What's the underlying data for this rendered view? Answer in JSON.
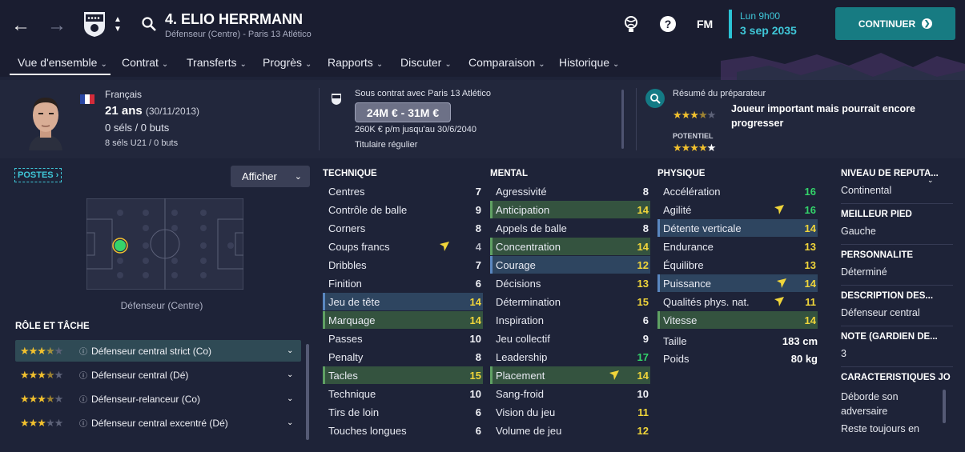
{
  "header": {
    "player_name": "4. ELIO HERRMANN",
    "player_sub": "Défenseur (Centre) - Paris 13 Atlético",
    "fm_logo": "FM",
    "date_day": "Lun 9h00",
    "date_full": "3 sep 2035",
    "continue_label": "CONTINUER"
  },
  "nav": {
    "items": [
      {
        "label": "Vue d'ensemble"
      },
      {
        "label": "Contrat"
      },
      {
        "label": "Transferts"
      },
      {
        "label": "Progrès"
      },
      {
        "label": "Rapports"
      },
      {
        "label": "Discuter"
      },
      {
        "label": "Comparaison"
      },
      {
        "label": "Historique"
      }
    ]
  },
  "profile": {
    "nationality": "Français",
    "age": "21 ans",
    "dob": "(30/11/2013)",
    "caps": "0 séls / 0 buts",
    "caps_u21": "8 séls U21 / 0 buts",
    "contract_title": "Sous contrat avec Paris 13 Atlético",
    "value": "24M € - 31M €",
    "wage": "260K € p/m jusqu'au 30/6/2040",
    "status": "Titulaire régulier",
    "scout_title": "Résumé du préparateur",
    "scout_text": "Joueur important mais pourrait encore progresser",
    "scout_stars": 3.5,
    "potential_label": "POTENTIEL",
    "potential_stars": 4.5
  },
  "left_panel": {
    "postes_label": "POSTES",
    "afficher_label": "Afficher",
    "position_label": "Défenseur (Centre)",
    "role_heading": "RÔLE ET TÂCHE",
    "roles": [
      {
        "name": "Défenseur central strict (Co)",
        "stars": 3.5,
        "selected": true
      },
      {
        "name": "Défenseur central (Dé)",
        "stars": 3.5,
        "selected": false
      },
      {
        "name": "Défenseur-relanceur (Co)",
        "stars": 3.5,
        "selected": false
      },
      {
        "name": "Défenseur central excentré (Dé)",
        "stars": 3,
        "selected": false
      }
    ]
  },
  "attributes": {
    "technique_title": "TECHNIQUE",
    "mental_title": "MENTAL",
    "physique_title": "PHYSIQUE",
    "technique": [
      {
        "name": "Centres",
        "value": "7",
        "tone": "w"
      },
      {
        "name": "Contrôle de balle",
        "value": "9",
        "tone": "w"
      },
      {
        "name": "Corners",
        "value": "8",
        "tone": "w"
      },
      {
        "name": "Coups francs",
        "value": "4",
        "tone": "g",
        "flag": true
      },
      {
        "name": "Dribbles",
        "value": "7",
        "tone": "w"
      },
      {
        "name": "Finition",
        "value": "6",
        "tone": "w"
      },
      {
        "name": "Jeu de tête",
        "value": "14",
        "tone": "y",
        "hl": "b"
      },
      {
        "name": "Marquage",
        "value": "14",
        "tone": "y",
        "hl": "g"
      },
      {
        "name": "Passes",
        "value": "10",
        "tone": "w"
      },
      {
        "name": "Penalty",
        "value": "8",
        "tone": "w"
      },
      {
        "name": "Tacles",
        "value": "15",
        "tone": "y",
        "hl": "g"
      },
      {
        "name": "Technique",
        "value": "10",
        "tone": "w"
      },
      {
        "name": "Tirs de loin",
        "value": "6",
        "tone": "w"
      },
      {
        "name": "Touches longues",
        "value": "6",
        "tone": "w"
      }
    ],
    "mental": [
      {
        "name": "Agressivité",
        "value": "8",
        "tone": "w"
      },
      {
        "name": "Anticipation",
        "value": "14",
        "tone": "y",
        "hl": "g"
      },
      {
        "name": "Appels de balle",
        "value": "8",
        "tone": "w"
      },
      {
        "name": "Concentration",
        "value": "14",
        "tone": "y",
        "hl": "g"
      },
      {
        "name": "Courage",
        "value": "12",
        "tone": "y",
        "hl": "b"
      },
      {
        "name": "Décisions",
        "value": "13",
        "tone": "y"
      },
      {
        "name": "Détermination",
        "value": "15",
        "tone": "y"
      },
      {
        "name": "Inspiration",
        "value": "6",
        "tone": "w"
      },
      {
        "name": "Jeu collectif",
        "value": "9",
        "tone": "w"
      },
      {
        "name": "Leadership",
        "value": "17",
        "tone": "gr"
      },
      {
        "name": "Placement",
        "value": "14",
        "tone": "y",
        "hl": "g",
        "flag": true
      },
      {
        "name": "Sang-froid",
        "value": "10",
        "tone": "w"
      },
      {
        "name": "Vision du jeu",
        "value": "11",
        "tone": "y"
      },
      {
        "name": "Volume de jeu",
        "value": "12",
        "tone": "y"
      }
    ],
    "physique": [
      {
        "name": "Accélération",
        "value": "16",
        "tone": "gr"
      },
      {
        "name": "Agilité",
        "value": "16",
        "tone": "gr",
        "flag": true
      },
      {
        "name": "Détente verticale",
        "value": "14",
        "tone": "y",
        "hl": "b"
      },
      {
        "name": "Endurance",
        "value": "13",
        "tone": "y"
      },
      {
        "name": "Équilibre",
        "value": "13",
        "tone": "y"
      },
      {
        "name": "Puissance",
        "value": "14",
        "tone": "y",
        "hl": "b",
        "flag": true
      },
      {
        "name": "Qualités phys. nat.",
        "value": "11",
        "tone": "y",
        "flag": true
      },
      {
        "name": "Vitesse",
        "value": "14",
        "tone": "y",
        "hl": "g"
      }
    ],
    "height_label": "Taille",
    "height": "183 cm",
    "weight_label": "Poids",
    "weight": "80 kg"
  },
  "right_panel": {
    "reputation_label": "NIVEAU DE RÉPUTA...",
    "reputation": "Continental",
    "foot_label": "MEILLEUR PIED",
    "foot": "Gauche",
    "personality_label": "PERSONNALITÉ",
    "personality": "Déterminé",
    "description_label": "DESCRIPTION DES...",
    "description": "Défenseur central",
    "gk_label": "NOTE (GARDIEN DE...",
    "gk": "3",
    "traits_label": "CARACTÉRISTIQUES JO",
    "trait_1": "Déborde son adversaire",
    "trait_2": "Reste toujours en"
  },
  "colors": {
    "accent": "#3fc7d8",
    "continue_bg": "#177b82",
    "good": "#33d36a",
    "medium": "#f0d53a",
    "star": "#f2c12e"
  }
}
